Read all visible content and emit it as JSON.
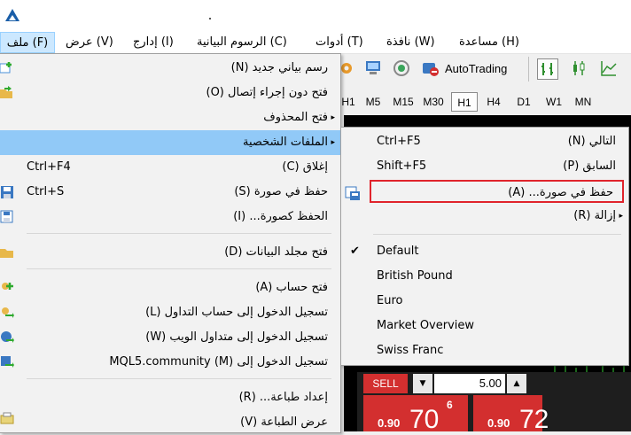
{
  "menubar": {
    "items": [
      {
        "label": "ملف (F)"
      },
      {
        "label": "عرض (V)"
      },
      {
        "label": "إدارج (I)"
      },
      {
        "label": "الرسوم البيانية (C)"
      },
      {
        "label": "أدوات (T)"
      },
      {
        "label": "نافذة (W)"
      },
      {
        "label": "مساعدة (H)"
      }
    ]
  },
  "toolbar": {
    "autotrading": "AutoTrading"
  },
  "timeframes": [
    "H1",
    "M5",
    "M15",
    "M30",
    "H1",
    "H4",
    "D1",
    "W1",
    "MN"
  ],
  "file_menu": {
    "items": [
      {
        "label": "رسم بياني جديد (N)",
        "shortcut": ""
      },
      {
        "label": "فتح دون إجراء إتصال (O)",
        "shortcut": ""
      },
      {
        "label": "فتح المحذوف",
        "shortcut": ""
      },
      {
        "label": "الملفات الشخصية",
        "shortcut": ""
      },
      {
        "label": "إغلاق (C)",
        "shortcut": "Ctrl+F4"
      },
      {
        "label": "حفظ في صورة (S)",
        "shortcut": "Ctrl+S"
      },
      {
        "label": "الحفظ كصورة... (I)",
        "shortcut": ""
      },
      {
        "label": "فتح مجلد البيانات (D)",
        "shortcut": ""
      },
      {
        "label": "فتح حساب (A)",
        "shortcut": ""
      },
      {
        "label": "تسجيل الدخول إلى حساب التداول (L)",
        "shortcut": ""
      },
      {
        "label": "تسجيل الدخول إلى متداول الويب (W)",
        "shortcut": ""
      },
      {
        "label": "تسجيل الدخول إلى MQL5.community (M)",
        "shortcut": ""
      },
      {
        "label": "إعداد طباعة... (R)",
        "shortcut": ""
      },
      {
        "label": "عرض الطباعة (V)",
        "shortcut": ""
      }
    ]
  },
  "profiles_menu": {
    "items": [
      {
        "label": "التالي (N)",
        "shortcut": "Ctrl+F5"
      },
      {
        "label": "السابق (P)",
        "shortcut": "Shift+F5"
      },
      {
        "label": "حفظ في صورة... (A)",
        "shortcut": ""
      },
      {
        "label": "إزالة (R)",
        "shortcut": ""
      },
      {
        "label": "Default",
        "shortcut": ""
      },
      {
        "label": "British Pound",
        "shortcut": ""
      },
      {
        "label": "Euro",
        "shortcut": ""
      },
      {
        "label": "Market Overview",
        "shortcut": ""
      },
      {
        "label": "Swiss Franc",
        "shortcut": ""
      }
    ],
    "checked_item": "Default"
  },
  "trade_panel": {
    "sell_label": "SELL",
    "lot_value": "5.00",
    "sell_price_small": "0.90",
    "sell_price_big": "70",
    "sell_price_sup": "6",
    "buy_price_small": "0.90",
    "buy_price_big": "72"
  },
  "colors": {
    "highlight": "#91c9f7",
    "selection_outline": "#e0242c",
    "sell_red": "#d32f2f",
    "chart_bg": "#000000"
  }
}
